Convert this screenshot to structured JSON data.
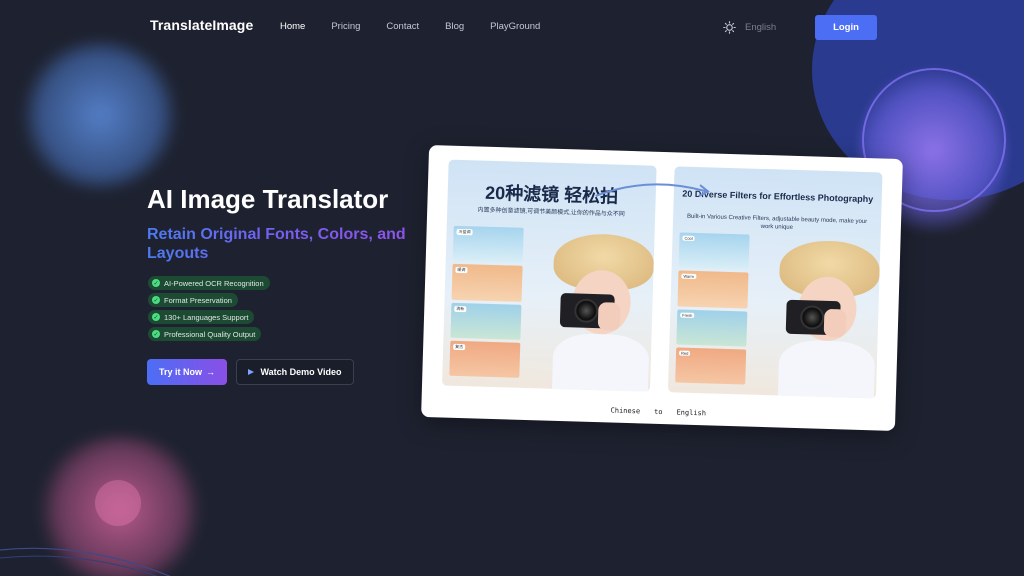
{
  "brand": {
    "logo": "TranslateImage"
  },
  "nav": {
    "items": [
      {
        "label": "Home",
        "active": true
      },
      {
        "label": "Pricing"
      },
      {
        "label": "Contact"
      },
      {
        "label": "Blog"
      },
      {
        "label": "PlayGround"
      }
    ]
  },
  "header": {
    "theme_icon": "sun-icon",
    "language": "English",
    "login_label": "Login"
  },
  "hero": {
    "title": "AI Image Translator",
    "subtitle": "Retain Original Fonts, Colors, and Layouts",
    "features": [
      "AI-Powered OCR Recognition",
      "Format Preservation",
      "130+ Languages Support",
      "Professional Quality Output"
    ],
    "primary_cta": "Try it Now",
    "secondary_cta": "Watch Demo Video"
  },
  "demo": {
    "left_title": "20种滤镜 轻松拍",
    "left_subtitle": "内置多种创意滤镜,可调节美颜模式,让你的作品与众不同",
    "right_title": "20 Diverse Filters for Effortless Photography",
    "right_subtitle": "Built-in Various Creative Filters, adjustable beauty mode, make your work unique",
    "left_tags": [
      "冷蓝调",
      "暖调",
      "清新",
      "复古"
    ],
    "right_tags": [
      "Cool",
      "Warm",
      "Fresh",
      "Red"
    ],
    "caption_from": "Chinese",
    "caption_to_word": "to",
    "caption_to": "English"
  },
  "colors": {
    "accent": "#4c6ef5",
    "accent_purple": "#8a4fe6",
    "background": "#1e2230",
    "badge": "#1d4a33",
    "check": "#4ade80"
  }
}
